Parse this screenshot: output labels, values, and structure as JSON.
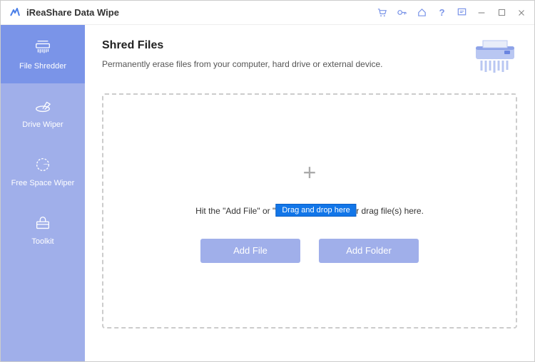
{
  "app": {
    "title": "iReaShare Data Wipe"
  },
  "titlebar": {
    "icons": {
      "cart": "cart-icon",
      "key": "key-icon",
      "home": "home-icon",
      "help": "help-icon",
      "feedback": "feedback-icon",
      "minimize": "minimize-icon",
      "maximize": "maximize-icon",
      "close": "close-icon"
    }
  },
  "sidebar": {
    "items": [
      {
        "label": "File Shredder",
        "icon": "shredder-icon",
        "active": true
      },
      {
        "label": "Drive Wiper",
        "icon": "drive-wiper-icon",
        "active": false
      },
      {
        "label": "Free Space Wiper",
        "icon": "free-space-icon",
        "active": false
      },
      {
        "label": "Toolkit",
        "icon": "toolkit-icon",
        "active": false
      }
    ]
  },
  "main": {
    "title": "Shred Files",
    "subtitle": "Permanently erase files from your computer, hard drive or external device.",
    "dropzone": {
      "hint": "Hit the \"Add File\" or \"Add Folder\" button, or drag file(s) here.",
      "tooltip": "Drag and drop here",
      "buttons": {
        "add_file": "Add File",
        "add_folder": "Add Folder"
      }
    }
  }
}
